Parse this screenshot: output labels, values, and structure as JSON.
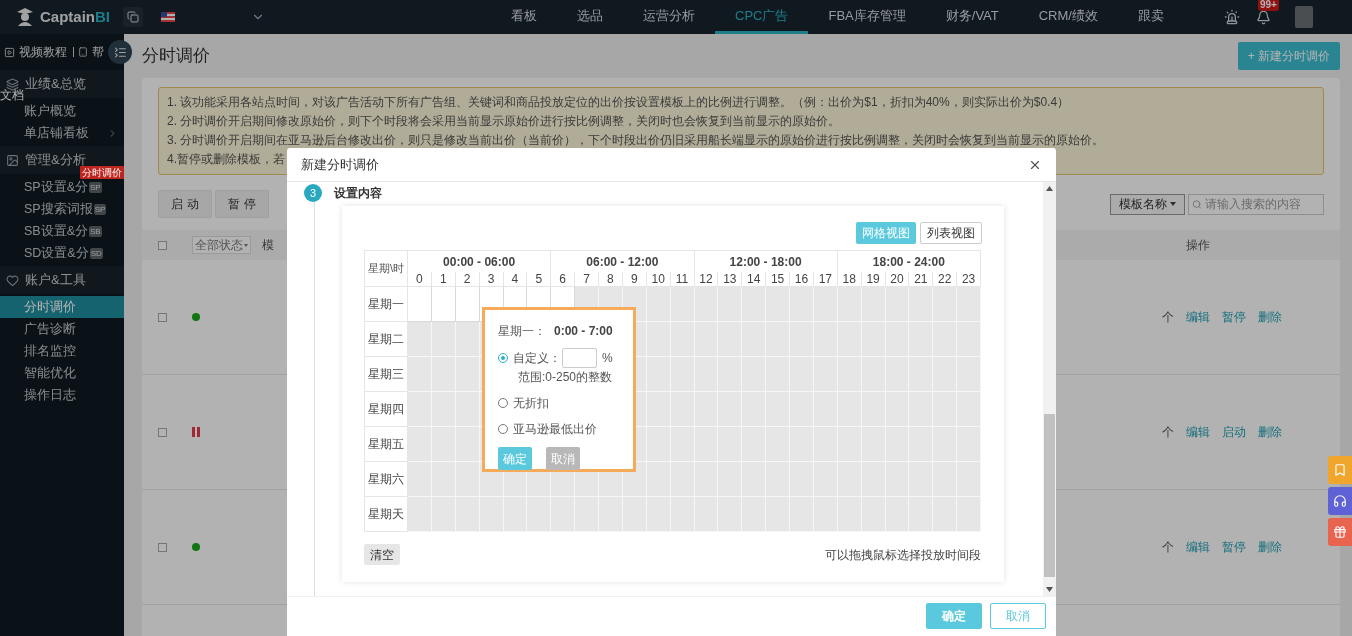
{
  "topbar": {
    "logo_text": "Captain",
    "logo_accent": "BI",
    "nav": [
      {
        "label": "看板",
        "selected": false
      },
      {
        "label": "选品",
        "selected": false
      },
      {
        "label": "运营分析",
        "selected": false
      },
      {
        "label": "CPC广告",
        "selected": true
      },
      {
        "label": "FBA库存管理",
        "selected": false
      },
      {
        "label": "财务/VAT",
        "selected": false
      },
      {
        "label": "CRM/绩效",
        "selected": false
      },
      {
        "label": "跟卖",
        "selected": false
      }
    ],
    "notification_badge": "99+"
  },
  "sidebar": {
    "links": [
      "视频教程",
      "帮"
    ],
    "doc_label": "文档",
    "sections": [
      {
        "title": "业绩&总览",
        "kind": "layers",
        "items": [
          {
            "label": "账户概览",
            "selected": false,
            "submenu": false
          },
          {
            "label": "单店铺看板",
            "selected": false,
            "submenu": true
          }
        ]
      },
      {
        "title": "管理&分析",
        "kind": "image",
        "items": [
          {
            "label": "SP设置&分",
            "tag": "SP",
            "badge": "分时调价",
            "selected": false,
            "submenu": false
          },
          {
            "label": "SP搜索词报",
            "tag": "SP",
            "selected": false,
            "submenu": false
          },
          {
            "label": "SB设置&分",
            "tag": "SB",
            "selected": false,
            "submenu": false
          },
          {
            "label": "SD设置&分",
            "tag": "SD",
            "selected": false,
            "submenu": false
          }
        ]
      },
      {
        "title": "账户&工具",
        "kind": "heart",
        "items": [
          {
            "label": "分时调价",
            "selected": true,
            "submenu": false
          },
          {
            "label": "广告诊断",
            "selected": false,
            "submenu": false
          },
          {
            "label": "排名监控",
            "selected": false,
            "submenu": false
          },
          {
            "label": "智能优化",
            "selected": false,
            "submenu": false
          },
          {
            "label": "操作日志",
            "selected": false,
            "submenu": false
          }
        ]
      }
    ]
  },
  "page": {
    "title": "分时调价",
    "new_button": "+ 新建分时调价",
    "notice": [
      "1. 该功能采用各站点时间，对该广告活动下所有广告组、关键词和商品投放定位的出价按设置模板上的比例进行调整。（例：出价为$1，折扣为40%，则实际出价为$0.4）",
      "2. 分时调价开启期间修改原始价，则下个时段将会采用当前显示原始价进行按比例调整，关闭时也会恢复到当前显示的原始价。",
      "3. 分时调价开启期间在亚马逊后台修改出价，则只是修改当前出价（当前价），下个时段出价仍旧采用船长端显示的原始价进行按比例调整，关闭时会恢复到当前显示的原始价。",
      "4.暂停或删除模板，若"
    ],
    "actions": [
      "启 动",
      "暂 停"
    ],
    "filter": {
      "select": "模板名称",
      "search_placeholder": "请输入搜索的内容"
    },
    "table": {
      "all_checked": false,
      "status_filter": "全部状态",
      "column_2_header": "模",
      "actions_header": "操作",
      "rows": [
        {
          "kind": "running",
          "checked": false,
          "column_3": "个",
          "actions": [
            "编辑",
            "暂停",
            "删除"
          ]
        },
        {
          "kind": "paused",
          "checked": false,
          "column_3": "个",
          "actions": [
            "编辑",
            "启动",
            "删除"
          ]
        },
        {
          "kind": "running",
          "checked": false,
          "column_3": "个",
          "actions": [
            "编辑",
            "暂停",
            "删除"
          ]
        }
      ]
    }
  },
  "floating_tools": [
    {
      "kind": "bookmark",
      "color": "#f0a52c"
    },
    {
      "kind": "headset",
      "color": "#5f62d6"
    },
    {
      "kind": "gift",
      "color": "#e8644f"
    }
  ],
  "modal": {
    "title": "新建分时调价",
    "step": {
      "number": "3",
      "title": "设置内容"
    },
    "views": [
      {
        "label": "网格视图",
        "selected": true
      },
      {
        "label": "列表视图",
        "selected": false
      }
    ],
    "grid": {
      "corner": "星期\\时",
      "ranges": [
        "00:00 - 06:00",
        "06:00 - 12:00",
        "12:00 - 18:00",
        "18:00 - 24:00"
      ],
      "hours": [
        "0",
        "1",
        "2",
        "3",
        "4",
        "5",
        "6",
        "7",
        "8",
        "9",
        "10",
        "11",
        "12",
        "13",
        "14",
        "15",
        "16",
        "17",
        "18",
        "19",
        "20",
        "21",
        "22",
        "23"
      ],
      "days": [
        {
          "label": "星期一",
          "slots": [
            true,
            true,
            true,
            true,
            true,
            true,
            true,
            false,
            false,
            false,
            false,
            false,
            false,
            false,
            false,
            false,
            false,
            false,
            false,
            false,
            false,
            false,
            false,
            false
          ]
        },
        {
          "label": "星期二"
        },
        {
          "label": "星期三"
        },
        {
          "label": "星期四"
        },
        {
          "label": "星期五"
        },
        {
          "label": "星期六"
        },
        {
          "label": "星期天"
        }
      ]
    },
    "popup": {
      "day": "星期一：",
      "time": "0:00 - 7:00",
      "options": [
        {
          "label": "自定义：",
          "kind": "custom",
          "selected": true
        },
        {
          "label": "无折扣",
          "kind": "plain",
          "selected": false
        },
        {
          "label": "亚马逊最低出价",
          "kind": "plain",
          "selected": false
        }
      ],
      "unit": "%",
      "hint": "范围:0-250的整数",
      "confirm": "确定",
      "cancel": "取消"
    },
    "clear_button": "清空",
    "drag_hint": "可以拖拽鼠标选择投放时间段",
    "footer": {
      "confirm": "确定",
      "cancel": "取消"
    }
  }
}
